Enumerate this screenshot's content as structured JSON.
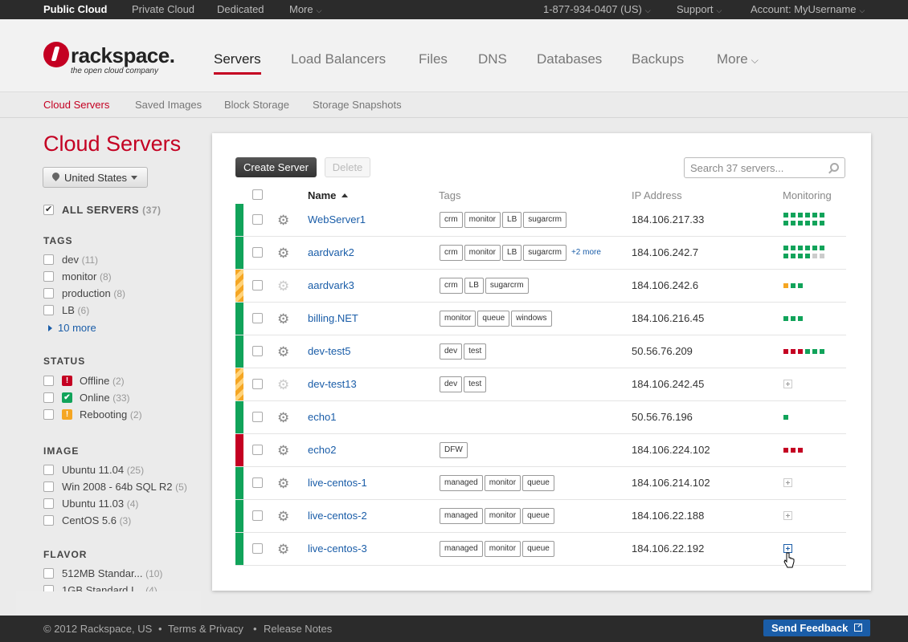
{
  "topbar": {
    "tabs": [
      "Public Cloud",
      "Private Cloud",
      "Dedicated",
      "More"
    ],
    "phone": "1-877-934-0407 (US)",
    "support": "Support",
    "account": "Account: MyUsername"
  },
  "brand": {
    "name": "rackspace.",
    "tagline": "the open cloud company"
  },
  "nav": [
    "Servers",
    "Load Balancers",
    "Files",
    "DNS",
    "Databases",
    "Backups",
    "More"
  ],
  "subnav": [
    "Cloud Servers",
    "Saved Images",
    "Block Storage",
    "Storage Snapshots"
  ],
  "sidebar": {
    "title": "Cloud Servers",
    "region": "United States",
    "all_servers": {
      "label": "ALL SERVERS",
      "count": "(37)"
    },
    "tags_head": "TAGS",
    "tags": [
      {
        "label": "dev",
        "count": "(11)"
      },
      {
        "label": "monitor",
        "count": "(8)"
      },
      {
        "label": "production",
        "count": "(8)"
      },
      {
        "label": "LB",
        "count": "(6)"
      }
    ],
    "more": "10 more",
    "status_head": "STATUS",
    "status": [
      {
        "label": "Offline",
        "count": "(2)",
        "color": "#c40022",
        "icon": "!"
      },
      {
        "label": "Online",
        "count": "(33)",
        "color": "#11a35a",
        "icon": "✔"
      },
      {
        "label": "Rebooting",
        "count": "(2)",
        "color": "#f5a623",
        "icon": "!"
      }
    ],
    "image_head": "IMAGE",
    "images": [
      {
        "label": "Ubuntu 11.04",
        "count": "(25)"
      },
      {
        "label": "Win 2008 - 64b SQL R2",
        "count": "(5)"
      },
      {
        "label": "Ubuntu 11.03",
        "count": "(4)"
      },
      {
        "label": "CentOS 5.6",
        "count": "(3)"
      }
    ],
    "flavor_head": "FLAVOR",
    "flavors": [
      {
        "label": "512MB Standar...",
        "count": "(10)"
      },
      {
        "label": "1GB Standard I...",
        "count": "(4)"
      }
    ]
  },
  "toolbar": {
    "create": "Create Server",
    "delete": "Delete",
    "search_placeholder": "Search 37 servers..."
  },
  "columns": {
    "name": "Name",
    "tags": "Tags",
    "ip": "IP Address",
    "monitoring": "Monitoring"
  },
  "servers": [
    {
      "name": "WebServer1",
      "status": "green",
      "tags": [
        "crm",
        "monitor",
        "LB",
        "sugarcrm"
      ],
      "more": "",
      "ip": "184.106.217.33",
      "monitoring": "gggggg,gggggg"
    },
    {
      "name": "aardvark2",
      "status": "green",
      "tags": [
        "crm",
        "monitor",
        "LB",
        "sugarcrm"
      ],
      "more": "+2 more",
      "ip": "184.106.242.7",
      "monitoring": "gggggg,ggggxx"
    },
    {
      "name": "aardvark3",
      "status": "warn",
      "tags": [
        "crm",
        "LB",
        "sugarcrm"
      ],
      "more": "",
      "ip": "184.106.242.6",
      "monitoring": "ogg"
    },
    {
      "name": "billing.NET",
      "status": "green",
      "tags": [
        "monitor",
        "queue",
        "windows"
      ],
      "more": "",
      "ip": "184.106.216.45",
      "monitoring": "ggg"
    },
    {
      "name": "dev-test5",
      "status": "green",
      "tags": [
        "dev",
        "test"
      ],
      "more": "",
      "ip": "50.56.76.209",
      "monitoring": "rrrggg"
    },
    {
      "name": "dev-test13",
      "status": "warn",
      "tags": [
        "dev",
        "test"
      ],
      "more": "",
      "ip": "184.106.242.45",
      "monitoring": "+"
    },
    {
      "name": "echo1",
      "status": "green",
      "tags": [],
      "more": "",
      "ip": "50.56.76.196",
      "monitoring": "g"
    },
    {
      "name": "echo2",
      "status": "red",
      "tags": [
        "DFW"
      ],
      "more": "",
      "ip": "184.106.224.102",
      "monitoring": "rrr"
    },
    {
      "name": "live-centos-1",
      "status": "green",
      "tags": [
        "managed",
        "monitor",
        "queue"
      ],
      "more": "",
      "ip": "184.106.214.102",
      "monitoring": "+"
    },
    {
      "name": "live-centos-2",
      "status": "green",
      "tags": [
        "managed",
        "monitor",
        "queue"
      ],
      "more": "",
      "ip": "184.106.22.188",
      "monitoring": "+"
    },
    {
      "name": "live-centos-3",
      "status": "green",
      "tags": [
        "managed",
        "monitor",
        "queue"
      ],
      "more": "",
      "ip": "184.106.22.192",
      "monitoring": "+hot"
    }
  ],
  "footer": {
    "copyright": "© 2012 Rackspace, US",
    "sep": "•",
    "terms": "Terms & Privacy",
    "release": "Release Notes",
    "feedback": "Send Feedback"
  }
}
